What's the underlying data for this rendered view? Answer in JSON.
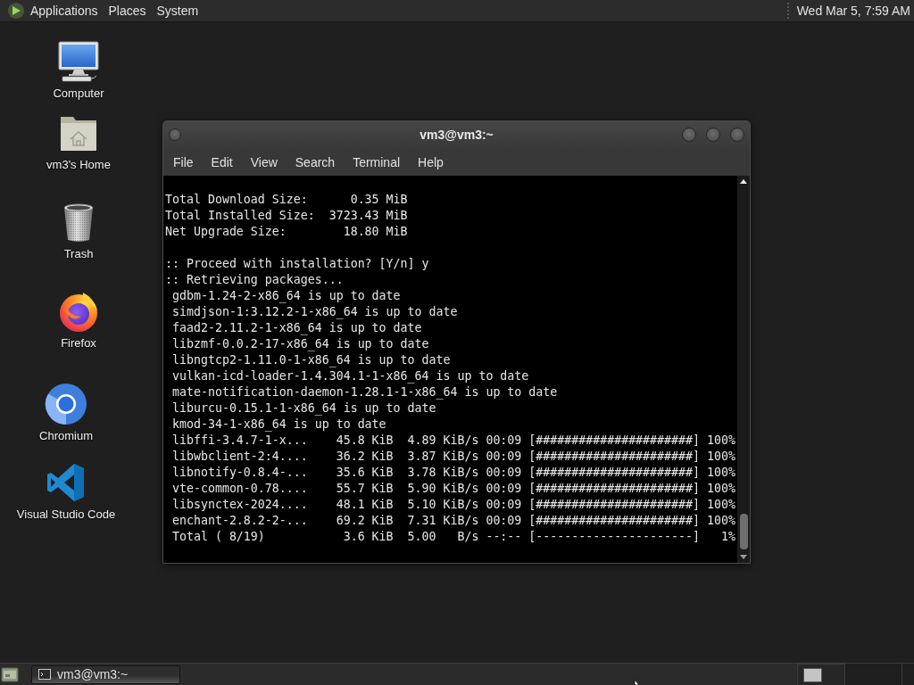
{
  "top_panel": {
    "menus": [
      "Applications",
      "Places",
      "System"
    ],
    "clock": "Wed Mar 5, 7:59 AM"
  },
  "desktop_icons": [
    {
      "label": "Computer",
      "kind": "computer"
    },
    {
      "label": "vm3's Home",
      "kind": "home"
    },
    {
      "label": "Trash",
      "kind": "trash"
    },
    {
      "label": "Firefox",
      "kind": "firefox"
    },
    {
      "label": "Chromium",
      "kind": "chromium"
    },
    {
      "label": "Visual Studio Code",
      "kind": "vscode"
    }
  ],
  "terminal_window": {
    "title": "vm3@vm3:~",
    "menu": [
      "File",
      "Edit",
      "View",
      "Search",
      "Terminal",
      "Help"
    ],
    "output_blocks": [
      {
        "lines": [
          "Total Download Size:      0.35 MiB",
          "Total Installed Size:  3723.43 MiB",
          "Net Upgrade Size:        18.80 MiB"
        ]
      },
      {
        "lines": [
          ":: Proceed with installation? [Y/n] y",
          ":: Retrieving packages...",
          " gdbm-1.24-2-x86_64 is up to date",
          " simdjson-1:3.12.2-1-x86_64 is up to date",
          " faad2-2.11.2-1-x86_64 is up to date",
          " libzmf-0.0.2-17-x86_64 is up to date",
          " libngtcp2-1.11.0-1-x86_64 is up to date",
          " vulkan-icd-loader-1.4.304.1-1-x86_64 is up to date",
          " mate-notification-daemon-1.28.1-1-x86_64 is up to date",
          " liburcu-0.15.1-1-x86_64 is up to date",
          " kmod-34-1-x86_64 is up to date",
          " libffi-3.4.7-1-x...    45.8 KiB  4.89 KiB/s 00:09 [######################] 100%",
          " libwbclient-2:4....    36.2 KiB  3.87 KiB/s 00:09 [######################] 100%",
          " libnotify-0.8.4-...    35.6 KiB  3.78 KiB/s 00:09 [######################] 100%",
          " vte-common-0.78....    55.7 KiB  5.90 KiB/s 00:09 [######################] 100%",
          " libsynctex-2024....    48.1 KiB  5.10 KiB/s 00:09 [######################] 100%",
          " enchant-2.8.2-2-...    69.2 KiB  7.31 KiB/s 00:09 [######################] 100%",
          " Total ( 8/19)           3.6 KiB  5.00   B/s --:-- [----------------------]   1%"
        ]
      }
    ]
  },
  "bottom_panel": {
    "taskbar": [
      {
        "label": "vm3@vm3:~"
      }
    ]
  }
}
